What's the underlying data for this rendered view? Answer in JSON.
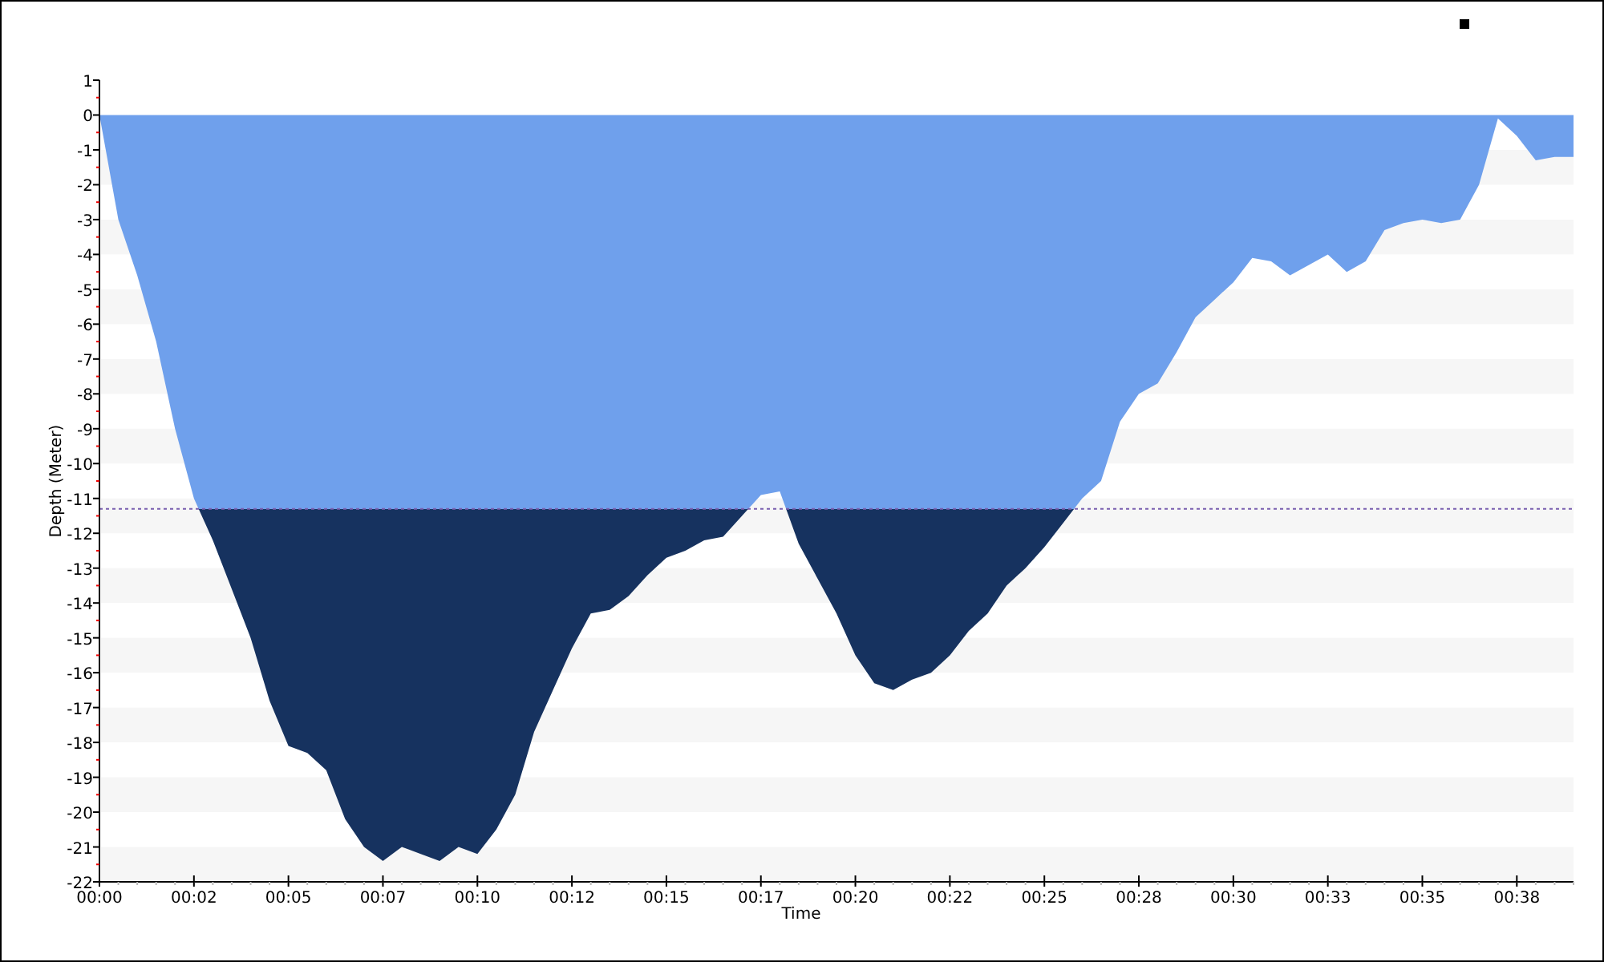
{
  "chart_data": {
    "type": "area",
    "xlabel": "Time",
    "ylabel": "Depth (Meter)",
    "x": [
      0,
      0.5,
      1,
      1.5,
      2,
      2.5,
      3,
      3.5,
      4,
      4.5,
      5,
      5.5,
      6,
      6.5,
      7,
      7.5,
      8,
      8.5,
      9,
      9.5,
      10,
      10.5,
      11,
      11.5,
      12,
      12.5,
      13,
      13.5,
      14,
      14.5,
      15,
      15.5,
      16,
      16.5,
      17,
      17.5,
      18,
      18.5,
      19,
      19.5,
      20,
      20.5,
      21,
      21.5,
      22,
      22.5,
      23,
      23.5,
      24,
      24.5,
      25,
      25.5,
      26,
      26.5,
      27,
      27.5,
      28,
      28.5,
      29,
      29.5,
      30,
      30.5,
      31,
      31.5,
      32,
      32.5,
      33,
      33.5,
      34,
      34.5,
      35,
      35.5,
      36,
      36.5,
      37,
      37.5,
      38,
      38.5,
      39
    ],
    "series": [
      {
        "color": "#6fa0ec",
        "values": [
          0,
          -3,
          -4.6,
          -6.5,
          -9,
          -11,
          -12.2,
          -13.6,
          -15,
          -16.8,
          -18.1,
          -18.3,
          -18.8,
          -20.2,
          -21,
          -21.4,
          -21,
          -21.2,
          -21.4,
          -21,
          -21.2,
          -20.5,
          -19.5,
          -17.7,
          -16.5,
          -15.3,
          -14.3,
          -14.2,
          -13.8,
          -13.2,
          -12.7,
          -12.5,
          -12.2,
          -12.1,
          -11.5,
          -10.9,
          -10.8,
          -12.3,
          -13.3,
          -14.3,
          -15.5,
          -16.3,
          -16.5,
          -16.2,
          -16,
          -15.5,
          -14.8,
          -14.3,
          -13.5,
          -13,
          -12.4,
          -11.7,
          -11,
          -10.5,
          -8.8,
          -8,
          -7.7,
          -6.8,
          -5.8,
          -5.3,
          -4.8,
          -4.1,
          -4.2,
          -4.6,
          -4.3,
          -4,
          -4.5,
          -4.2,
          -3.3,
          -3.1,
          -3,
          -3.1,
          -3,
          -2,
          -0.1,
          -0.6,
          -1.3,
          -1.2,
          -1.2
        ]
      }
    ],
    "xlim": [
      0,
      39
    ],
    "ylim": [
      -22,
      1
    ],
    "xticks": [
      {
        "value": 0,
        "label": "00:00"
      },
      {
        "value": 2.5,
        "label": "00:02"
      },
      {
        "value": 5,
        "label": "00:05"
      },
      {
        "value": 7.5,
        "label": "00:07"
      },
      {
        "value": 10,
        "label": "00:10"
      },
      {
        "value": 12.5,
        "label": "00:12"
      },
      {
        "value": 15,
        "label": "00:15"
      },
      {
        "value": 17.5,
        "label": "00:17"
      },
      {
        "value": 20,
        "label": "00:20"
      },
      {
        "value": 22.5,
        "label": "00:22"
      },
      {
        "value": 25,
        "label": "00:25"
      },
      {
        "value": 27.5,
        "label": "00:28"
      },
      {
        "value": 30,
        "label": "00:30"
      },
      {
        "value": 32.5,
        "label": "00:33"
      },
      {
        "value": 35,
        "label": "00:35"
      },
      {
        "value": 37.5,
        "label": "00:38"
      }
    ],
    "yticks": [
      1,
      0,
      -1,
      -2,
      -3,
      -4,
      -5,
      -6,
      -7,
      -8,
      -9,
      -10,
      -11,
      -12,
      -13,
      -14,
      -15,
      -16,
      -17,
      -18,
      -19,
      -20,
      -21,
      -22
    ],
    "ref_lines": [
      {
        "axis": "y",
        "value": -11.3,
        "color": "#7a5fb0"
      }
    ]
  }
}
